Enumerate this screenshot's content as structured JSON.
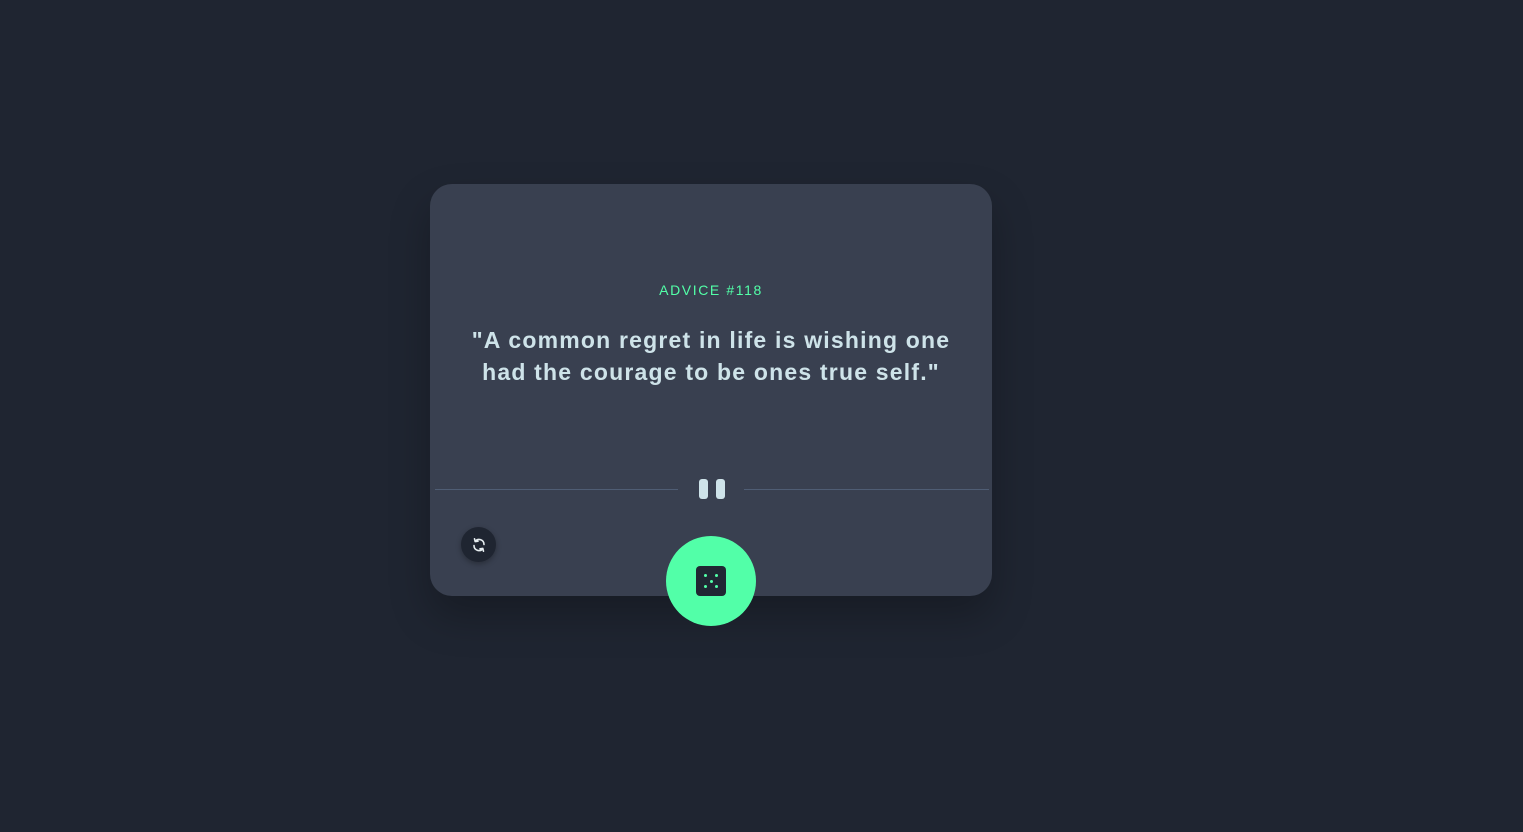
{
  "advice": {
    "label": "ADVICE #118",
    "quote": "\"A common regret in life is wishing one had the courage to be ones true self.\""
  },
  "icons": {
    "divider": "pause-icon",
    "refresh": "refresh-icon",
    "dice": "dice-icon"
  },
  "colors": {
    "background": "#1f2531",
    "card": "#394050",
    "accent": "#52ffa8",
    "text": "#cee3e9",
    "divider_line": "#4f5d74"
  }
}
